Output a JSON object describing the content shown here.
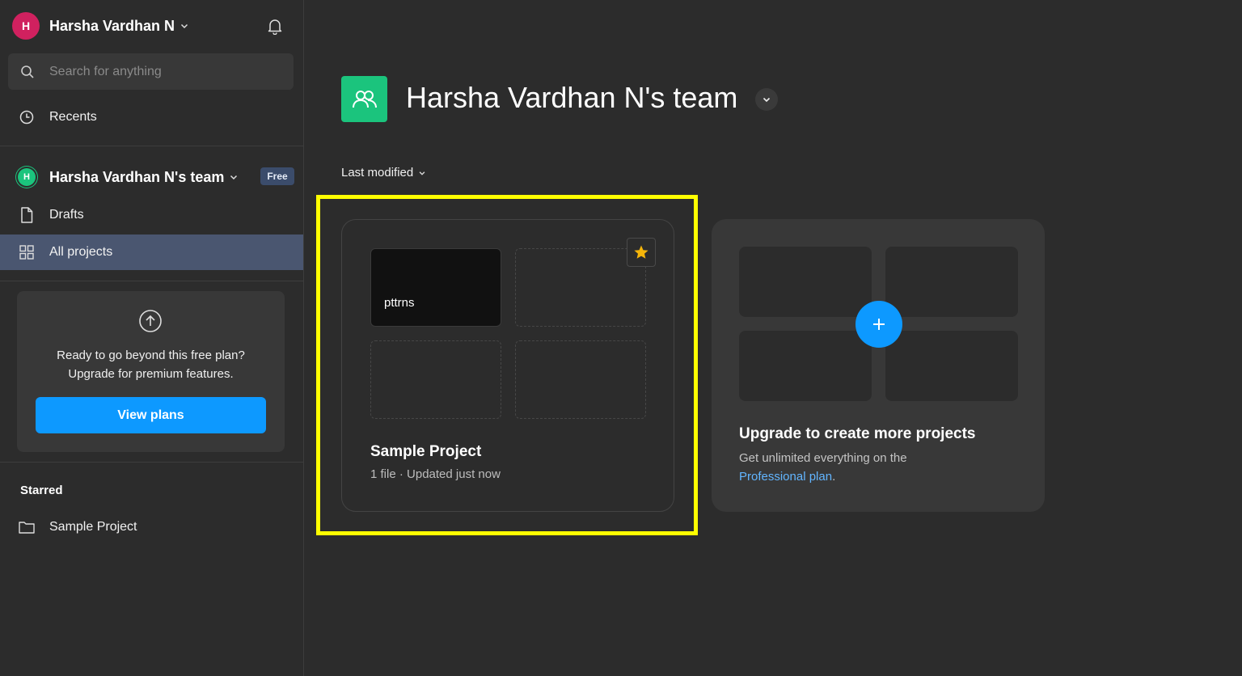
{
  "user": {
    "initial": "H",
    "name": "Harsha Vardhan N"
  },
  "search": {
    "placeholder": "Search for anything"
  },
  "sidebar": {
    "recents": "Recents",
    "team": {
      "initial": "H",
      "name": "Harsha Vardhan N's team",
      "badge": "Free"
    },
    "drafts": "Drafts",
    "all_projects": "All projects",
    "upgrade": {
      "line1": "Ready to go beyond this free plan?",
      "line2": "Upgrade for premium features.",
      "button": "View plans"
    },
    "starred": {
      "heading": "Starred",
      "items": [
        {
          "label": "Sample Project"
        }
      ]
    }
  },
  "main": {
    "title": "Harsha Vardhan N's team",
    "sort_label": "Last modified",
    "project": {
      "thumbnail_label": "pttrns",
      "name": "Sample Project",
      "meta": "1 file · Updated just now",
      "starred": true
    },
    "upgrade_card": {
      "title": "Upgrade to create more projects",
      "desc_prefix": "Get unlimited everything on the",
      "link_text": "Professional plan",
      "desc_suffix": "."
    }
  },
  "colors": {
    "background": "#2c2c2c",
    "accent_blue": "#0d99ff",
    "team_green": "#1bc47d",
    "avatar_pink": "#d0215f",
    "active_nav": "#4a5670",
    "highlight_yellow": "#ffff00",
    "star_gold": "#f5b50a"
  }
}
